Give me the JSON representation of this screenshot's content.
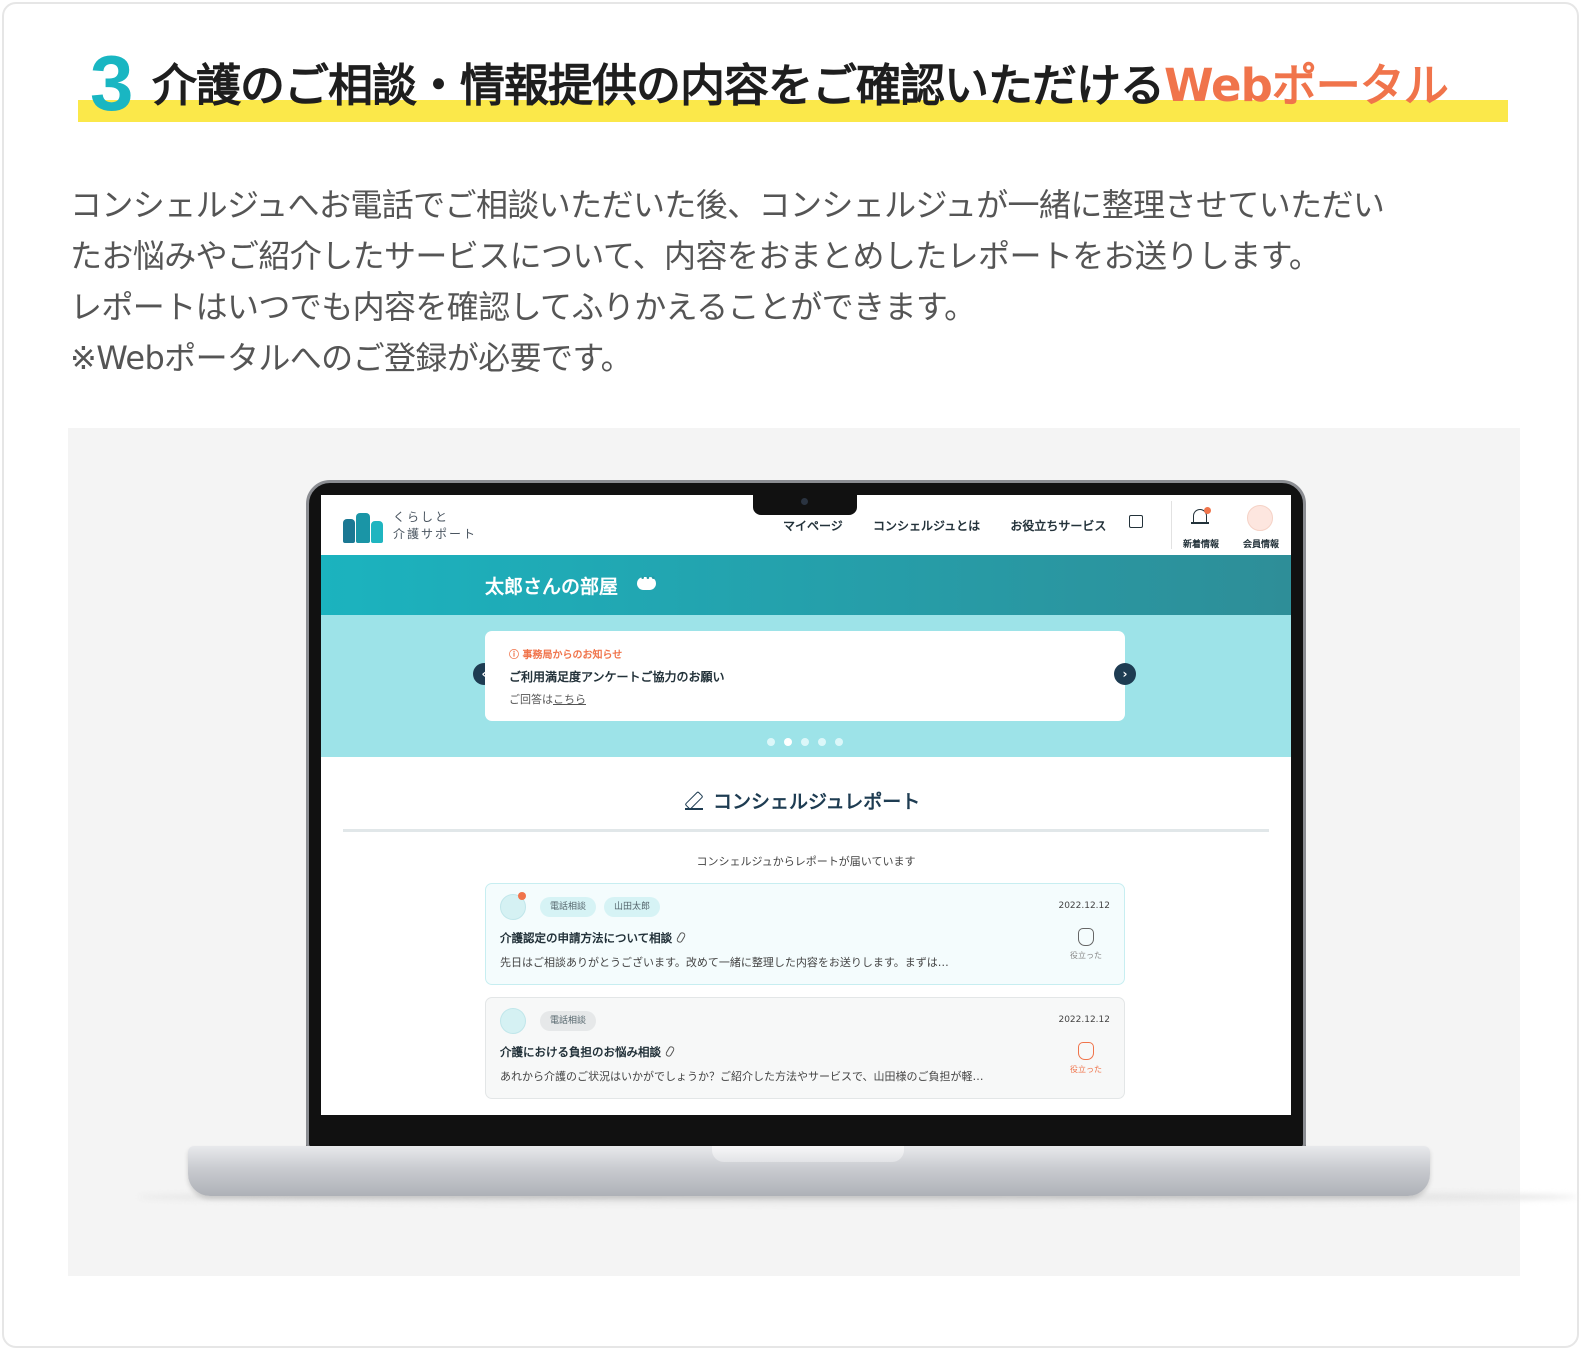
{
  "headline": {
    "number": "3",
    "text": "介護のご相談・情報提供の内容をご確認いただける",
    "accent": "Webポータル"
  },
  "description": [
    "コンシェルジュへお電話でご相談いただいた後、コンシェルジュが一緒に整理させていただい",
    "たお悩みやご紹介したサービスについて、内容をおまとめしたレポートをお送りします。",
    "レポートはいつでも内容を確認してふりかえることができます。",
    "※Webポータルへのご登録が必要です。"
  ],
  "portal": {
    "logo": {
      "line1": "くらしと",
      "line2": "介護サポート"
    },
    "nav": [
      "マイページ",
      "コンシェルジュとは",
      "お役立ちサービス"
    ],
    "header_icons": {
      "chat": "chat-icon",
      "bell": "bell-icon",
      "bell_label": "新着情報",
      "member_label": "会員情報"
    },
    "room_title": "太郎さんの部屋",
    "notice": {
      "tag": "ⓘ 事務局からのお知らせ",
      "title": "ご利用満足度アンケートご協力のお願い",
      "sub_prefix": "ご回答は",
      "sub_link": "こちら",
      "prev": "‹",
      "next": "›",
      "active_dot": 2,
      "dot_count": 5
    },
    "report_section": {
      "heading": "コンシェルジュレポート",
      "lead": "コンシェルジュからレポートが届いています"
    },
    "reports": [
      {
        "chips": [
          "電話相談",
          "山田太郎"
        ],
        "date": "2022.12.12",
        "title": "介護認定の申請方法について相談",
        "body": "先日はご相談ありがとうございます。改めて一緒に整理した内容をお送りします。まずは…",
        "helpful_label": "役立った",
        "helpful_active": false,
        "unread": true
      },
      {
        "chips": [
          "電話相談"
        ],
        "date": "2022.12.12",
        "title": "介護における負担のお悩み相談",
        "body": "あれから介護のご状況はいかがでしょうか？ご紹介した方法やサービスで、山田様のご負担が軽…",
        "helpful_label": "役立った",
        "helpful_active": true,
        "unread": false
      }
    ]
  },
  "colors": {
    "accent_teal": "#19b6c2",
    "accent_orange": "#f0744b",
    "highlight_yellow": "#fbe84a",
    "navy": "#1e3c52"
  }
}
